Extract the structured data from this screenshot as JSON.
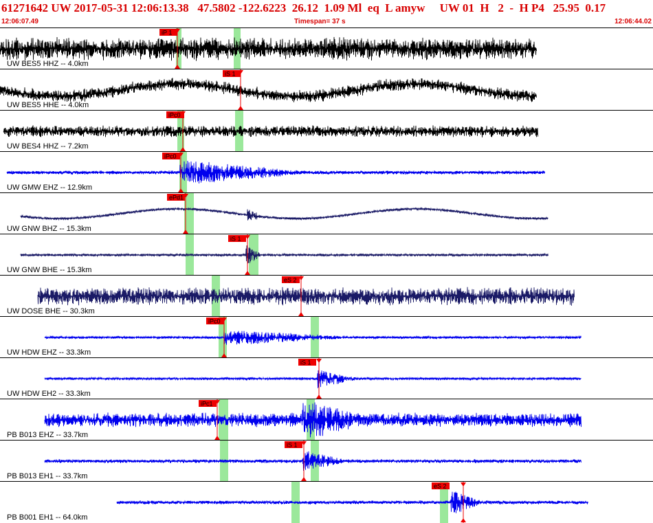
{
  "header": {
    "event_line": "61271642 UW 2017-05-31 12:06:13.38   47.5802 -122.6223  26.12  1.09 Ml  eq  L amyw     UW 01  H   2  -  H P4   25.95  0.17",
    "start_time": "12:06:07.49",
    "timespan": "Timespan=  37 s",
    "end_time": "12:06:44.02",
    "text_color": "#d80000"
  },
  "colors": {
    "trace_black": "#000000",
    "trace_navy": "#1a1a66",
    "trace_blue": "#0000ee",
    "pick_flag": "#ee0000",
    "pick_window": "#9be89b"
  },
  "channels": [
    {
      "label": "UW BES5 HHZ -- 4.0km",
      "color": "trace_black",
      "picks": [
        {
          "text": "iP 1",
          "type": "P"
        }
      ]
    },
    {
      "label": "UW BES5 HHE -- 4.0km",
      "color": "trace_black",
      "picks": [
        {
          "text": "iS 1",
          "type": "S"
        }
      ]
    },
    {
      "label": "UW BES4 HHZ -- 7.2km",
      "color": "trace_black",
      "picks": [
        {
          "text": "iPc0",
          "type": "P"
        }
      ]
    },
    {
      "label": "UW GMW EHZ -- 12.9km",
      "color": "trace_blue",
      "picks": [
        {
          "text": "iPc0",
          "type": "P"
        }
      ]
    },
    {
      "label": "UW GNW BHZ -- 15.3km",
      "color": "trace_navy",
      "picks": [
        {
          "text": "ePd1",
          "type": "P"
        }
      ]
    },
    {
      "label": "UW GNW BHE -- 15.3km",
      "color": "trace_navy",
      "picks": [
        {
          "text": "iS 1",
          "type": "S"
        }
      ]
    },
    {
      "label": "UW DOSE BHE -- 30.3km",
      "color": "trace_navy",
      "picks": [
        {
          "text": "eS 2",
          "type": "S"
        }
      ]
    },
    {
      "label": "UW HDW EHZ -- 33.3km",
      "color": "trace_blue",
      "picks": [
        {
          "text": "iPc0",
          "type": "P"
        }
      ]
    },
    {
      "label": "UW HDW EH2 -- 33.3km",
      "color": "trace_blue",
      "picks": [
        {
          "text": "iS 1",
          "type": "S"
        }
      ]
    },
    {
      "label": "PB B013 EHZ -- 33.7km",
      "color": "trace_blue",
      "picks": [
        {
          "text": "iPc1",
          "type": "P"
        }
      ]
    },
    {
      "label": "PB B013 EH1 -- 33.7km",
      "color": "trace_blue",
      "picks": [
        {
          "text": "iS 1",
          "type": "S"
        }
      ]
    },
    {
      "label": "PB B001 EH1 -- 64.0km",
      "color": "trace_blue",
      "picks": [
        {
          "text": "eS 2",
          "type": "S"
        }
      ]
    }
  ]
}
